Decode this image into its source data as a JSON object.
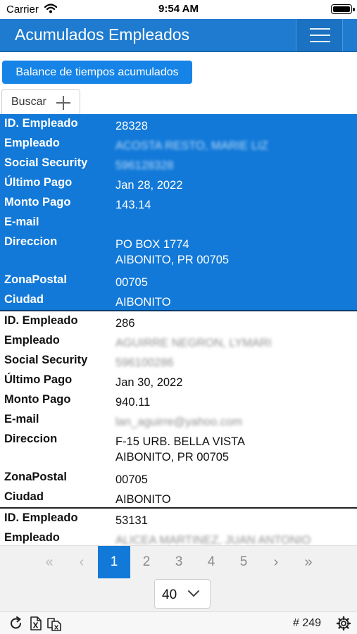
{
  "status_bar": {
    "carrier": "Carrier",
    "time": "9:54 AM"
  },
  "header": {
    "title": "Acumulados Empleados"
  },
  "actions": {
    "balance_label": "Balance de tiempos acumulados",
    "search_label": "Buscar"
  },
  "records": [
    {
      "selected": true,
      "id_label": "ID. Empleado",
      "id": "28328",
      "name_label": "Empleado",
      "name": "ACOSTA RESTO, MARIE LIZ",
      "ss_label": "Social Security",
      "ss": "596128328",
      "pay_label": "Último Pago",
      "pay": "Jan 28, 2022",
      "amount_label": "Monto Pago",
      "amount": "143.14",
      "email_label": "E-mail",
      "email": "",
      "address_label": "Direccion",
      "address1": "PO BOX 1774",
      "address2": "AIBONITO, PR 00705",
      "zip_label": "ZonaPostal",
      "zip": "00705",
      "city_label": "Ciudad",
      "city": "AIBONITO"
    },
    {
      "selected": false,
      "id_label": "ID. Empleado",
      "id": "286",
      "name_label": "Empleado",
      "name": "AGUIRRE NEGRON, LYMARI",
      "ss_label": "Social Security",
      "ss": "596100286",
      "pay_label": "Último Pago",
      "pay": "Jan 30, 2022",
      "amount_label": "Monto Pago",
      "amount": "940.11",
      "email_label": "E-mail",
      "email": "lan_aguirre@yahoo.com",
      "address_label": "Direccion",
      "address1": "F-15 URB. BELLA VISTA",
      "address2": "AIBONITO, PR  00705",
      "zip_label": "ZonaPostal",
      "zip": "00705",
      "city_label": "Ciudad",
      "city": "AIBONITO"
    },
    {
      "selected": false,
      "id_label": "ID. Empleado",
      "id": "53131",
      "name_label": "Empleado",
      "name": "ALICEA MARTINEZ, JUAN ANTONIO"
    }
  ],
  "pagination": {
    "first": "«",
    "prev": "‹",
    "next": "›",
    "last": "»",
    "pages": [
      "1",
      "2",
      "3",
      "4",
      "5"
    ],
    "active_page": "1",
    "page_size": "40"
  },
  "footer": {
    "count": "# 249"
  },
  "icons": [
    "wifi-icon",
    "battery-icon",
    "menu-icon",
    "plus-icon",
    "chevron-down-icon",
    "refresh-icon",
    "excel-export-icon",
    "copy-icon",
    "gear-icon"
  ],
  "colors": {
    "header": "#1f7bcf",
    "selected_row": "#1279d8",
    "button": "#1684e6"
  }
}
